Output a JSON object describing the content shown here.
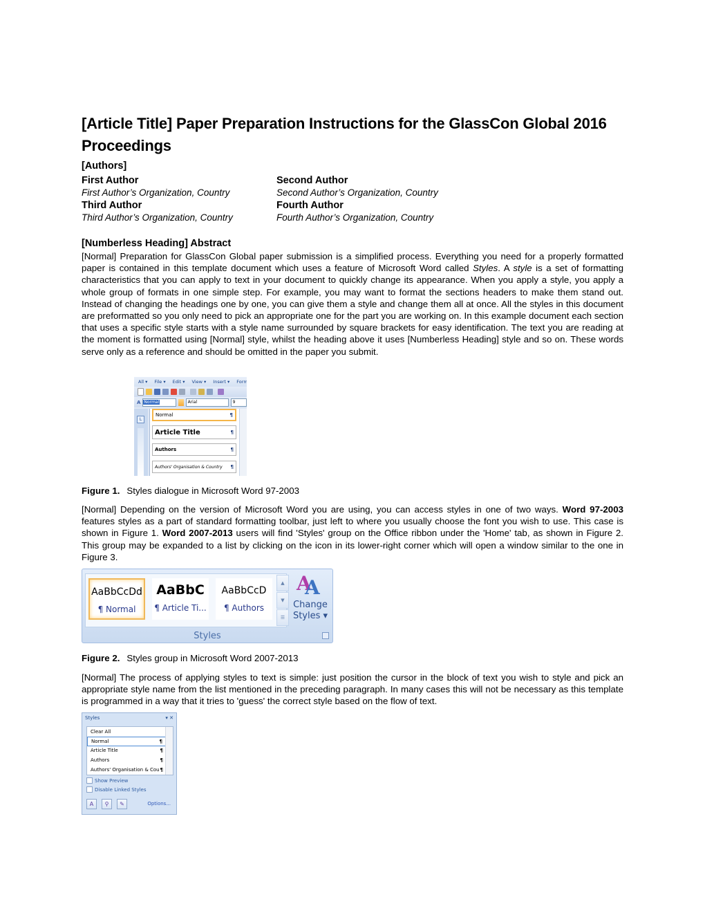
{
  "title": "[Article Title] Paper Preparation Instructions for the GlassCon Global 2016 Proceedings",
  "authors_label": "[Authors]",
  "authors": [
    {
      "name": "First Author",
      "org": "First Author’s Organization, Country"
    },
    {
      "name": "Second Author",
      "org": "Second Author’s Organization, Country"
    },
    {
      "name": "Third Author",
      "org": "Third Author’s Organization, Country"
    },
    {
      "name": "Fourth Author",
      "org": "Fourth Author’s Organization, Country"
    }
  ],
  "abstract": {
    "heading": "[Numberless Heading] Abstract",
    "p1": "[Normal] Preparation for GlassCon Global paper submission is a simplified process. Everything you need for a properly formatted paper is contained in this template document which uses a feature of Microsoft Word called ",
    "p1_em1": "Styles",
    "p1_b": ". A ",
    "p1_em2": "style",
    "p1_c": " is a set of formatting characteristics that you can apply to text in your document to quickly change its appearance. When you apply a style, you apply a whole group of formats in one simple step. For example, you may want to format the sections headers to make them stand out. Instead of changing the headings one by one, you can give them a style and change them all at once. All the styles in this document are preformatted so you only need to pick an appropriate one for the part you are working on. In this example document each section that uses a specific style starts with a style name surrounded by square brackets for easy identification. The text you are reading at the moment is formatted using [Normal] style, whilst the heading above it uses [Numberless Heading] style and so on. These words serve only as a reference and should be omitted in the paper you submit."
  },
  "figure1": {
    "caption_label": "Figure 1.",
    "caption_text": "Styles dialogue in Microsoft Word 97-2003",
    "menu": [
      "All ▾",
      "File ▾",
      "Edit ▾",
      "View ▾",
      "Insert ▾",
      "Form"
    ],
    "style_value": "Normal",
    "font_value": "Arial",
    "size_value": "9",
    "ruler_tab": "L",
    "styles": [
      "Normal",
      "Article Title",
      "Authors",
      "Authors' Organisation & Country"
    ],
    "pilcrow": "¶"
  },
  "para2": {
    "a": "[Normal] Depending on the version of Microsoft Word you are using, you can access styles in one of two ways. ",
    "b1": "Word 97-2003",
    "c": " features styles as a part of standard formatting toolbar, just left to where you usually choose the font you wish to use. This case is shown in Figure 1. ",
    "b2": "Word 2007-2013",
    "d": " users will find 'Styles' group on the Office ribbon under the 'Home' tab, as shown in Figure 2. This group may be expanded to a list by clicking on the icon in its lower-right corner which will open a window similar to the one in Figure 3."
  },
  "figure2": {
    "caption_label": "Figure 2.",
    "caption_text": "Styles group in Microsoft Word 2007-2013",
    "tiles": [
      {
        "sample": "AaBbCcDd",
        "name": "¶ Normal"
      },
      {
        "sample": "AaBbC",
        "name": "¶ Article Ti..."
      },
      {
        "sample": "AaBbCcD",
        "name": "¶ Authors"
      }
    ],
    "change_styles_line1": "Change",
    "change_styles_line2": "Styles ▾",
    "group_label": "Styles",
    "scroll_up": "▲",
    "scroll_down": "▼",
    "more": "☰"
  },
  "para3": "[Normal] The process of applying styles to text is simple: just position the cursor in the block of text you wish to style and pick an appropriate style name from the list mentioned in the preceding paragraph. In many cases this will not be necessary as this template is programmed in a way that it tries to 'guess' the correct style based on the flow of text.",
  "figure3": {
    "pane_title": "Styles",
    "pane_controls": "▾  ✕",
    "items": [
      {
        "label": "Clear All",
        "mark": ""
      },
      {
        "label": "Normal",
        "mark": "¶"
      },
      {
        "label": "Article Title",
        "mark": "¶"
      },
      {
        "label": "Authors",
        "mark": "¶"
      },
      {
        "label": "Authors' Organisation & Cou",
        "mark": "¶"
      }
    ],
    "show_preview": "Show Preview",
    "disable_linked": "Disable Linked Styles",
    "options": "Options..."
  }
}
